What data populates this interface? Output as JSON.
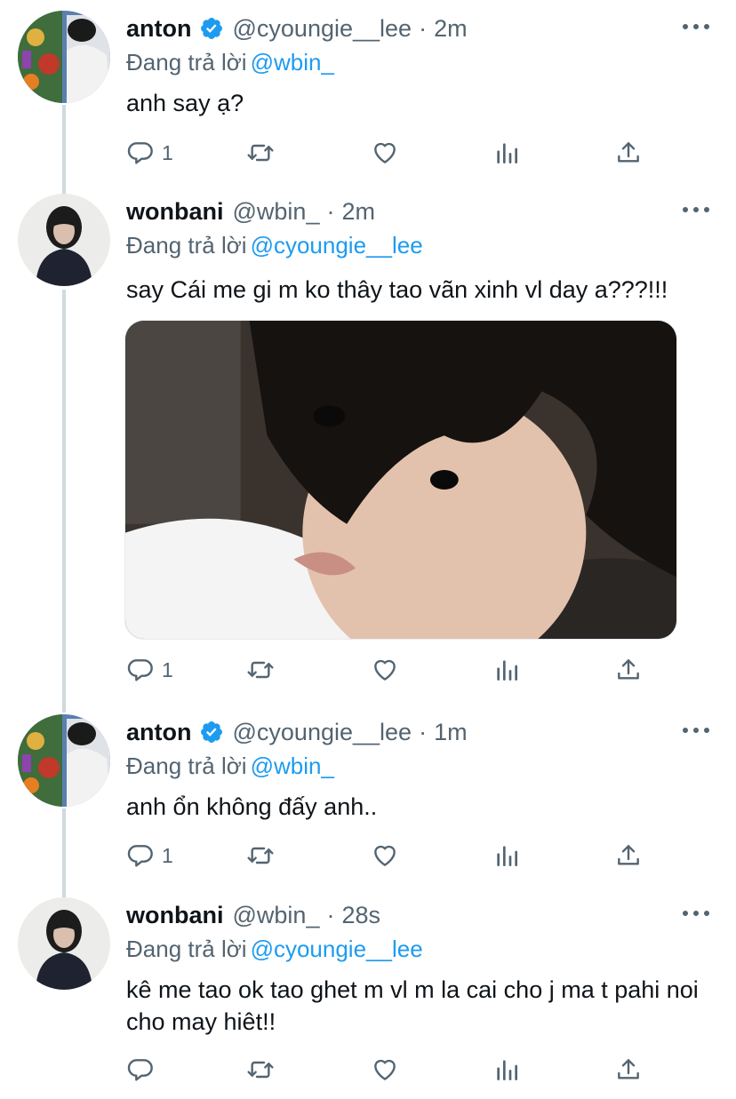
{
  "tweets": [
    {
      "name": "anton",
      "verified": true,
      "handle": "@cyoungie__lee",
      "separator": "·",
      "time": "2m",
      "reply_prefix": "Đang trả lời",
      "reply_mention": "@wbin_",
      "text": "anh say ạ?",
      "reply_count": "1"
    },
    {
      "name": "wonbani",
      "verified": false,
      "handle": "@wbin_",
      "separator": "·",
      "time": "2m",
      "reply_prefix": "Đang trả lời",
      "reply_mention": "@cyoungie__lee",
      "text": "say Cái me gi m ko thây tao vãn xinh vl day a???!!!",
      "reply_count": "1"
    },
    {
      "name": "anton",
      "verified": true,
      "handle": "@cyoungie__lee",
      "separator": "·",
      "time": "1m",
      "reply_prefix": "Đang trả lời",
      "reply_mention": "@wbin_",
      "text": "anh ổn không đấy anh..",
      "reply_count": "1"
    },
    {
      "name": "wonbani",
      "verified": false,
      "handle": "@wbin_",
      "separator": "·",
      "time": "28s",
      "reply_prefix": "Đang trả lời",
      "reply_mention": "@cyoungie__lee",
      "text": "kê me tao ok tao ghet m vl m la cai cho j ma t pahi noi cho may hiêt!!",
      "reply_count": ""
    }
  ],
  "icons": {
    "reply": "reply-icon",
    "retweet": "retweet-icon",
    "like": "heart-icon",
    "analytics": "analytics-icon",
    "share": "share-icon",
    "more": "more-options-icon",
    "verified": "verified-badge-icon"
  },
  "colors": {
    "text": "#0f1419",
    "secondary": "#536471",
    "link": "#1d9bf0",
    "verified": "#1d9bf0",
    "thread_line": "#cfd9de"
  }
}
